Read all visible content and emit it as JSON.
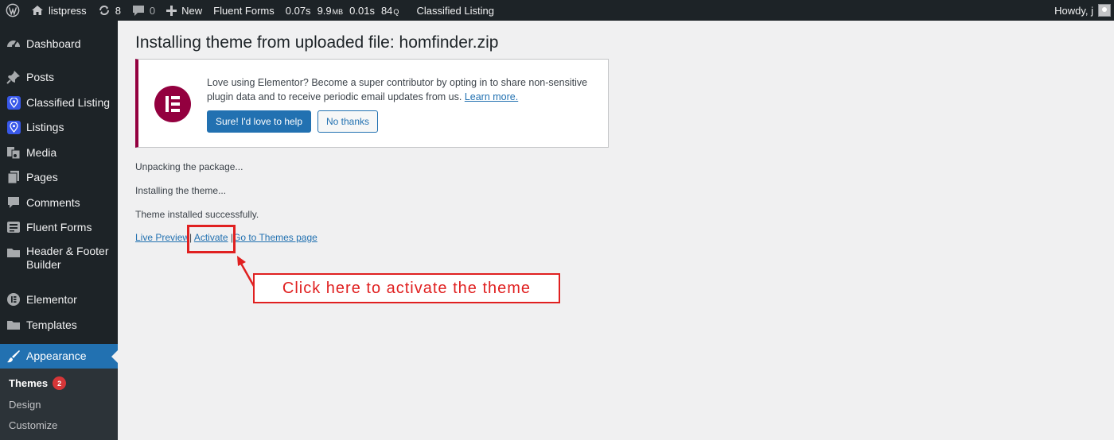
{
  "adminbar": {
    "site_name": "listpress",
    "updates_count": "8",
    "comments_count": "0",
    "new_label": "New",
    "fluent_forms": "Fluent Forms",
    "stats": [
      "0.07s",
      "9.9",
      "MB",
      "0.01s",
      "84",
      "Q"
    ],
    "classified": "Classified Listing",
    "howdy": "Howdy, j"
  },
  "sidebar": {
    "items": [
      {
        "label": "Dashboard",
        "icon": "dashboard-icon"
      },
      {
        "label": "Posts",
        "icon": "pin-icon"
      },
      {
        "label": "Classified Listing",
        "icon": "location-pin-icon"
      },
      {
        "label": "Listings",
        "icon": "location-pin-icon"
      },
      {
        "label": "Media",
        "icon": "media-icon"
      },
      {
        "label": "Pages",
        "icon": "pages-icon"
      },
      {
        "label": "Comments",
        "icon": "comment-icon"
      },
      {
        "label": "Fluent Forms",
        "icon": "forms-icon"
      },
      {
        "label": "Header & Footer Builder",
        "icon": "folder-icon"
      },
      {
        "label": "Elementor",
        "icon": "elementor-icon"
      },
      {
        "label": "Templates",
        "icon": "folder-icon"
      },
      {
        "label": "Appearance",
        "icon": "brush-icon"
      }
    ],
    "submenu": [
      {
        "label": "Themes",
        "badge": "2"
      },
      {
        "label": "Design"
      },
      {
        "label": "Customize"
      }
    ]
  },
  "main": {
    "title": "Installing theme from uploaded file: homfinder.zip",
    "notice": {
      "text": "Love using Elementor? Become a super contributor by opting in to share non-sensitive plugin data and to receive periodic email updates from us.",
      "link": "Learn more.",
      "primary_button": "Sure! I'd love to help",
      "secondary_button": "No thanks"
    },
    "status": [
      "Unpacking the package...",
      "Installing the theme...",
      "Theme installed successfully."
    ],
    "links": {
      "live_preview": "Live Preview",
      "sep": "|",
      "activate": "Activate",
      "themes_page": "Go to Themes page"
    },
    "callout": "Click here to activate the theme"
  },
  "colors": {
    "admin_bg": "#1d2327",
    "accent": "#2271b1",
    "elementor": "#93003f",
    "annotation": "#e02020"
  }
}
